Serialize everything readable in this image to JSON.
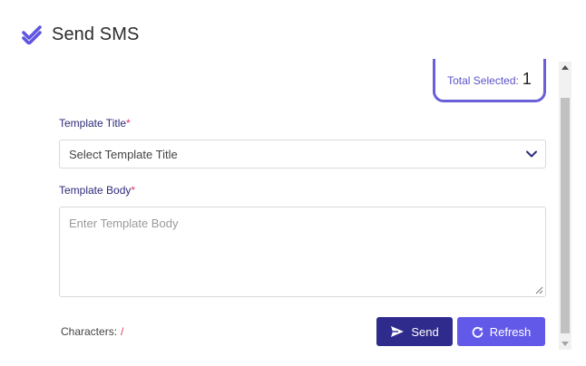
{
  "header": {
    "title": "Send SMS",
    "icon": "double-check-icon"
  },
  "summary": {
    "label": "Total Selected:",
    "count": "1"
  },
  "template_title": {
    "label": "Template Title",
    "required_mark": "*",
    "selected": "Select Template Title"
  },
  "template_body": {
    "label": "Template Body",
    "required_mark": "*",
    "placeholder": "Enter Template Body",
    "value": ""
  },
  "characters": {
    "label": "Characters:",
    "value": "/"
  },
  "buttons": {
    "send": "Send",
    "refresh": "Refresh"
  },
  "colors": {
    "accent": "#6259e8",
    "accent_dark": "#2f2b8c",
    "label": "#2e2a7a",
    "required": "#e0355a"
  }
}
